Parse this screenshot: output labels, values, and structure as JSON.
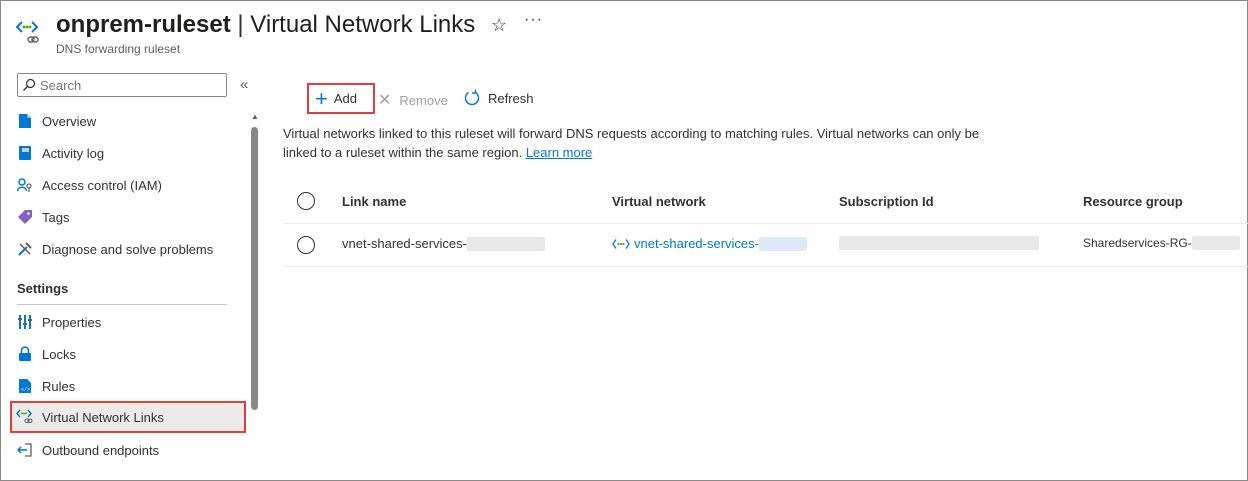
{
  "header": {
    "resource_name": "onprem-ruleset",
    "separator": "|",
    "page_name": "Virtual Network Links",
    "subtitle": "DNS forwarding ruleset",
    "star_icon": "☆",
    "more_icon": "···"
  },
  "sidebar": {
    "search_placeholder": "Search",
    "collapse_icon": "«",
    "items": [
      {
        "label": "Overview",
        "icon": "overview-icon"
      },
      {
        "label": "Activity log",
        "icon": "activity-log-icon"
      },
      {
        "label": "Access control (IAM)",
        "icon": "iam-icon"
      },
      {
        "label": "Tags",
        "icon": "tag-icon"
      },
      {
        "label": "Diagnose and solve problems",
        "icon": "diagnose-icon"
      }
    ],
    "settings_label": "Settings",
    "settings_items": [
      {
        "label": "Properties",
        "icon": "properties-icon"
      },
      {
        "label": "Locks",
        "icon": "lock-icon"
      },
      {
        "label": "Rules",
        "icon": "rules-icon"
      },
      {
        "label": "Virtual Network Links",
        "icon": "virtual-network-links-icon",
        "active": true
      },
      {
        "label": "Outbound endpoints",
        "icon": "outbound-endpoints-icon"
      }
    ]
  },
  "toolbar": {
    "add_label": "Add",
    "remove_label": "Remove",
    "refresh_label": "Refresh"
  },
  "info": {
    "text": "Virtual networks linked to this ruleset will forward DNS requests according to matching rules. Virtual networks can only be linked to a ruleset within the same region.",
    "link_label": "Learn more"
  },
  "table": {
    "columns": [
      "Link name",
      "Virtual network",
      "Subscription Id",
      "Resource group"
    ],
    "rows": [
      {
        "link_name": "vnet-shared-services-",
        "virtual_network": "vnet-shared-services-",
        "subscription_id": "",
        "resource_group": "Sharedservices-RG-"
      }
    ]
  },
  "colors": {
    "accent": "#0078d4",
    "highlight_border": "#e03e3e",
    "active_bg": "#edebe9"
  }
}
